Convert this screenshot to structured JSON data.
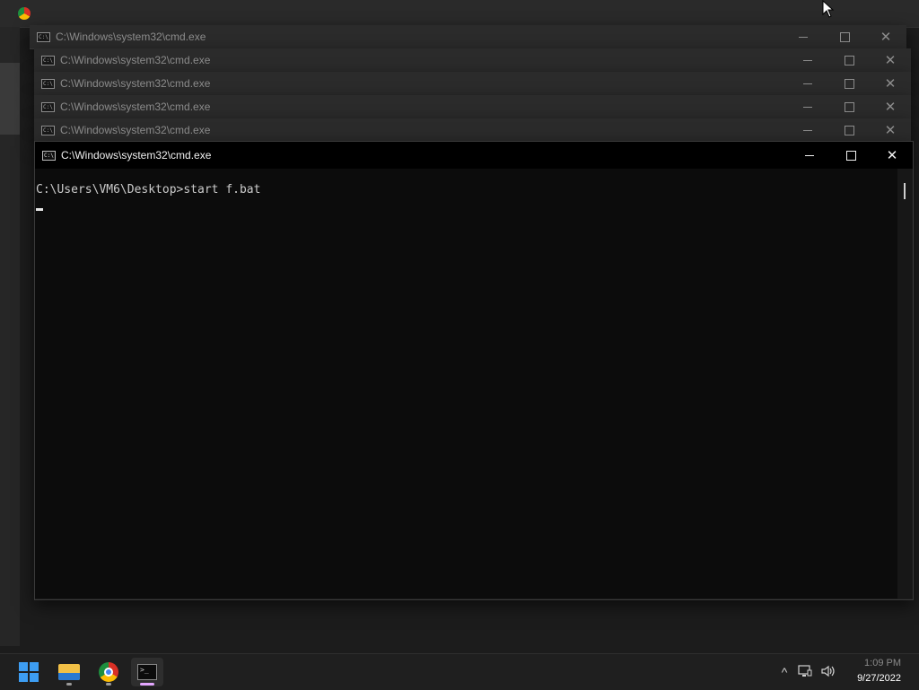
{
  "desktop": {},
  "windows": {
    "title": "C:\\Windows\\system32\\cmd.exe",
    "icon": "cmd-icon",
    "controls": {
      "minimize": "minimize-icon",
      "maximize": "maximize-icon",
      "close": "✕"
    }
  },
  "console": {
    "prompt_line": "C:\\Users\\VM6\\Desktop>start f.bat"
  },
  "taskbar": {
    "apps": [
      {
        "name": "start",
        "icon": "windows-logo-icon"
      },
      {
        "name": "file-explorer",
        "icon": "folder-icon"
      },
      {
        "name": "chrome",
        "icon": "chrome-icon"
      },
      {
        "name": "terminal",
        "icon": "terminal-icon",
        "active": true
      }
    ],
    "tray": {
      "chevron": "^",
      "network_icon": "network-icon",
      "volume_icon": "volume-icon"
    },
    "clock": {
      "time": "1:09 PM",
      "date": "9/27/2022"
    }
  },
  "colors": {
    "console_bg": "#0c0c0c",
    "console_text": "#cccccc",
    "active_titlebar": "#000000",
    "inactive_titlebar": "#2b2b2b",
    "start_blue": "#3d9df2",
    "terminal_indicator": "#e3a6ff"
  }
}
